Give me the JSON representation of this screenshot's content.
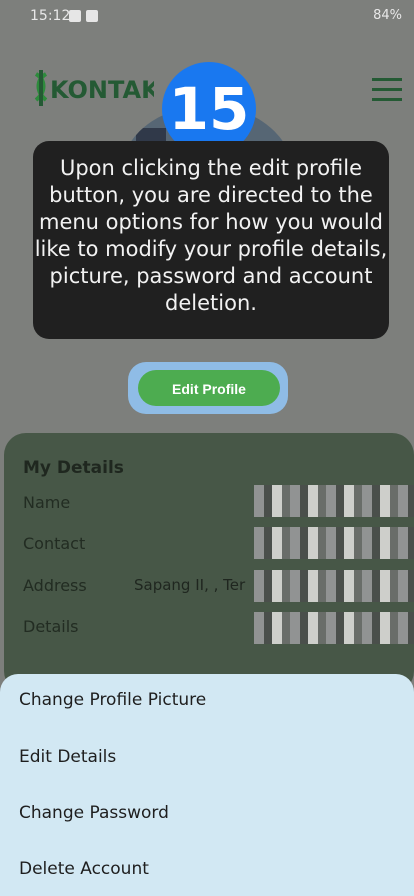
{
  "status": {
    "time": "15:12",
    "battery": "84%"
  },
  "app": {
    "logo_text": "KONTAK"
  },
  "tutorial": {
    "step": "15",
    "message": "Upon clicking the edit profile button, you are directed to the menu options for how you would like to modify your profile details, picture, password and account deletion."
  },
  "profile": {
    "edit_label": "Edit Profile"
  },
  "details": {
    "title": "My Details",
    "rows": [
      {
        "label": "Name",
        "value": ""
      },
      {
        "label": "Contact",
        "value": ""
      },
      {
        "label": "Address",
        "value": "Sapang II, , Ter"
      },
      {
        "label": "Details",
        "value": ""
      }
    ]
  },
  "sheet": {
    "items": [
      "Change Profile Picture",
      "Edit Details",
      "Change Password",
      "Delete Account"
    ]
  }
}
